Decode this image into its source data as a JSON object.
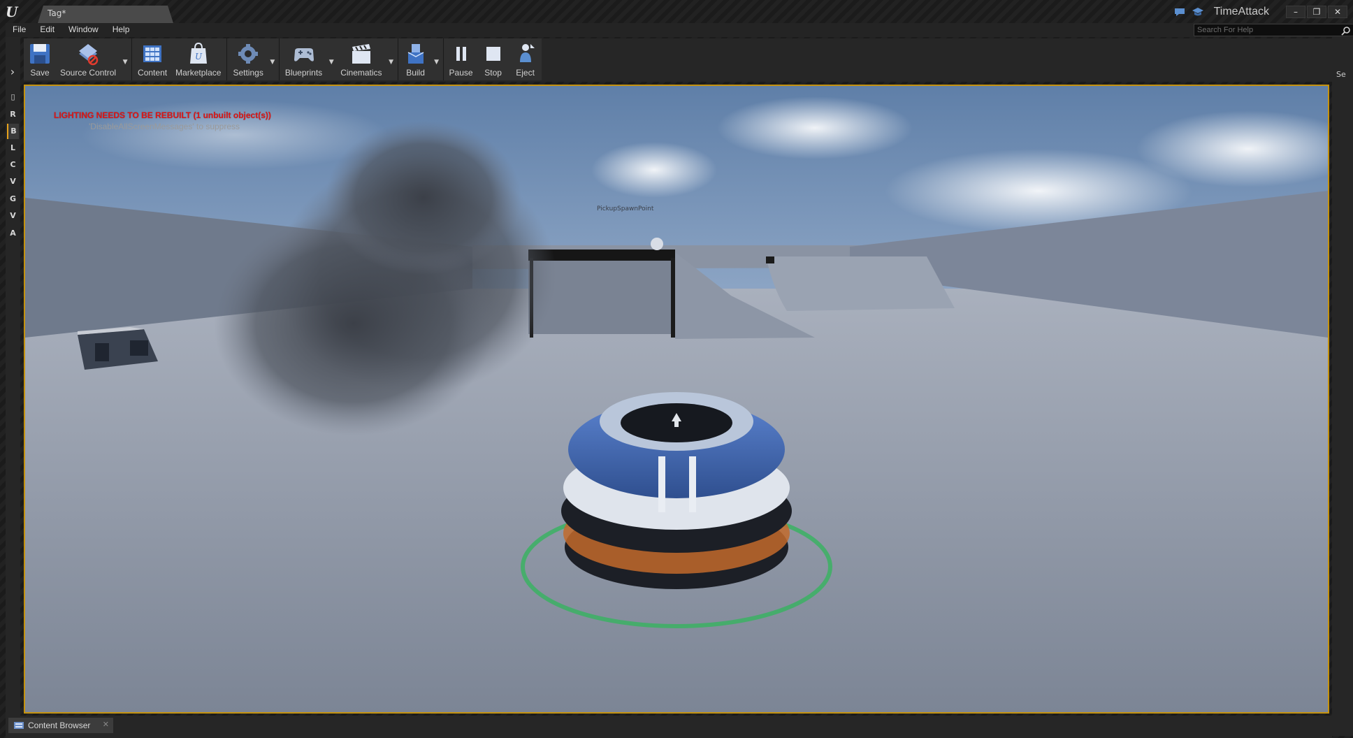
{
  "window": {
    "tab_title": "Tag*",
    "project_name": "TimeAttack",
    "buttons": {
      "minimize": "–",
      "restore": "❐",
      "close": "✕"
    }
  },
  "menu": {
    "items": [
      "File",
      "Edit",
      "Window",
      "Help"
    ],
    "help_search_placeholder": "Search For Help"
  },
  "toolbar": {
    "save": "Save",
    "source_control": "Source Control",
    "content": "Content",
    "marketplace": "Marketplace",
    "settings": "Settings",
    "blueprints": "Blueprints",
    "cinematics": "Cinematics",
    "build": "Build",
    "pause": "Pause",
    "stop": "Stop",
    "eject": "Eject"
  },
  "mode_tabs": [
    "R",
    "B",
    "L",
    "C",
    "V",
    "G",
    "V",
    "A"
  ],
  "active_mode_index": 1,
  "right_panel_label": "Se",
  "viewport": {
    "lighting_message": "LIGHTING NEEDS TO BE REBUILT (1 unbuilt object(s))",
    "suppress_message": "'DisableAllScreenMessages' to suppress",
    "world_label": "PickupSpawnPoint",
    "border_color": "#c4920f"
  },
  "bottom": {
    "content_browser_tab": "Content Browser",
    "close_glyph": "✕"
  },
  "icons": {
    "save": "floppy-disk-icon",
    "source_control": "source-control-disabled-icon",
    "content": "content-grid-icon",
    "marketplace": "marketplace-bag-icon",
    "settings": "settings-gears-icon",
    "blueprints": "gamepad-icon",
    "cinematics": "clapperboard-icon",
    "build": "build-boxes-icon",
    "pause": "pause-icon",
    "stop": "stop-icon",
    "eject": "eject-person-icon"
  }
}
